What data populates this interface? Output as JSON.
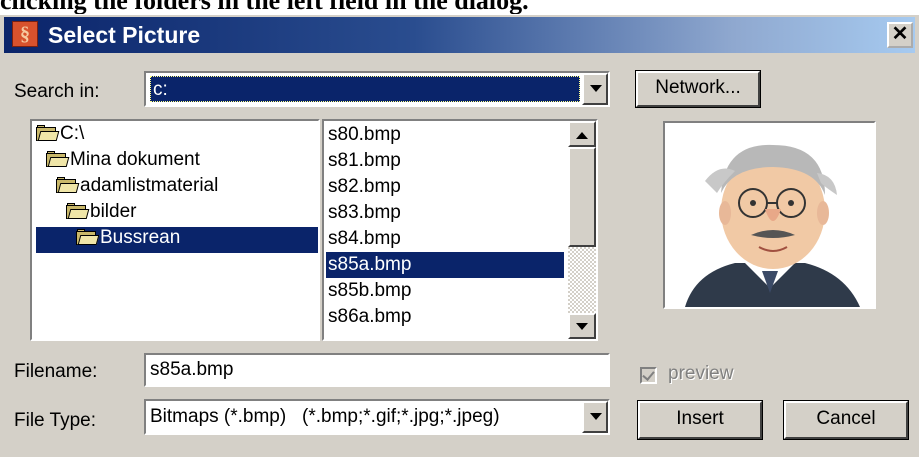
{
  "caption": "clicking the folders in the left field in the dialog.",
  "window": {
    "title": "Select Picture",
    "close_glyph": "✕"
  },
  "search": {
    "label": "Search in:",
    "value": "c:"
  },
  "network_button": "Network...",
  "folders": [
    {
      "label": "C:\\",
      "selected": false
    },
    {
      "label": "Mina dokument",
      "selected": false
    },
    {
      "label": "adamlistmaterial",
      "selected": false
    },
    {
      "label": "bilder",
      "selected": false
    },
    {
      "label": "Bussrean",
      "selected": true
    }
  ],
  "files": [
    {
      "name": "s80.bmp",
      "selected": false
    },
    {
      "name": "s81.bmp",
      "selected": false
    },
    {
      "name": "s82.bmp",
      "selected": false
    },
    {
      "name": "s83.bmp",
      "selected": false
    },
    {
      "name": "s84.bmp",
      "selected": false
    },
    {
      "name": "s85a.bmp",
      "selected": true
    },
    {
      "name": "s85b.bmp",
      "selected": false
    },
    {
      "name": "s86a.bmp",
      "selected": false
    }
  ],
  "filename": {
    "label": "Filename:",
    "value": "s85a.bmp"
  },
  "filetype": {
    "label": "File Type:",
    "value": "Bitmaps (*.bmp)   (*.bmp;*.gif;*.jpg;*.jpeg)"
  },
  "preview": {
    "label": "preview",
    "checked": true,
    "enabled": false
  },
  "insert_button": "Insert",
  "cancel_button": "Cancel",
  "icons": {
    "app": "app-icon",
    "folder": "folder-icon",
    "dropdown": "chevron-down-icon",
    "scroll_up": "scroll-up-icon",
    "scroll_down": "scroll-down-icon"
  },
  "colors": {
    "selection": "#0a246a",
    "dialog_bg": "#d4d0c8",
    "title_start": "#0a246a",
    "title_end": "#a6caf0"
  }
}
